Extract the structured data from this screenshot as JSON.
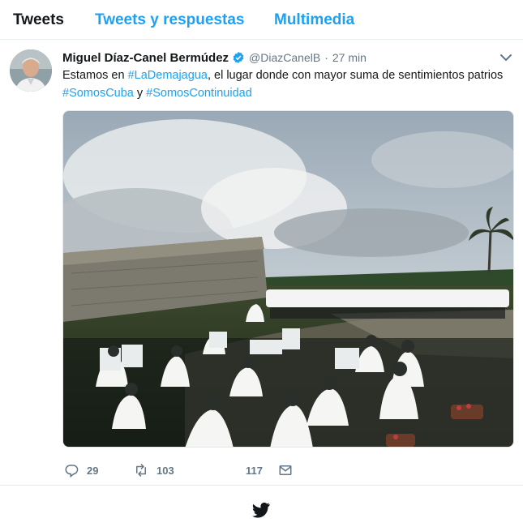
{
  "tabs": [
    {
      "label": "Tweets",
      "active": true
    },
    {
      "label": "Tweets y respuestas",
      "active": false
    },
    {
      "label": "Multimedia",
      "active": false
    }
  ],
  "tweet": {
    "author_name": "Miguel Díaz-Canel Bermúdez",
    "verified_icon": "verified-badge-icon",
    "handle": "@DiazCanelB",
    "separator": "·",
    "time": "27 min",
    "text_parts": {
      "p1": "Estamos en ",
      "h1": "#LaDemajagua",
      "p2": ", el lugar donde con mayor suma de sentimientos patrios ",
      "h2": "#SomosCuba",
      "p3": " y ",
      "h3": "#SomosContinuidad"
    },
    "media_icon": "photo-orchestra-concert"
  },
  "actions": {
    "reply_count": "29",
    "retweet_count": "103",
    "like_count": "117",
    "reply_icon": "reply-icon",
    "retweet_icon": "retweet-icon",
    "like_icon": "heart-icon",
    "dm_icon": "envelope-icon"
  },
  "footer": {
    "icon": "twitter-bird-icon"
  },
  "colors": {
    "accent": "#1da1f2",
    "text": "#14171a",
    "muted": "#657786",
    "border": "#e6ecf0"
  }
}
